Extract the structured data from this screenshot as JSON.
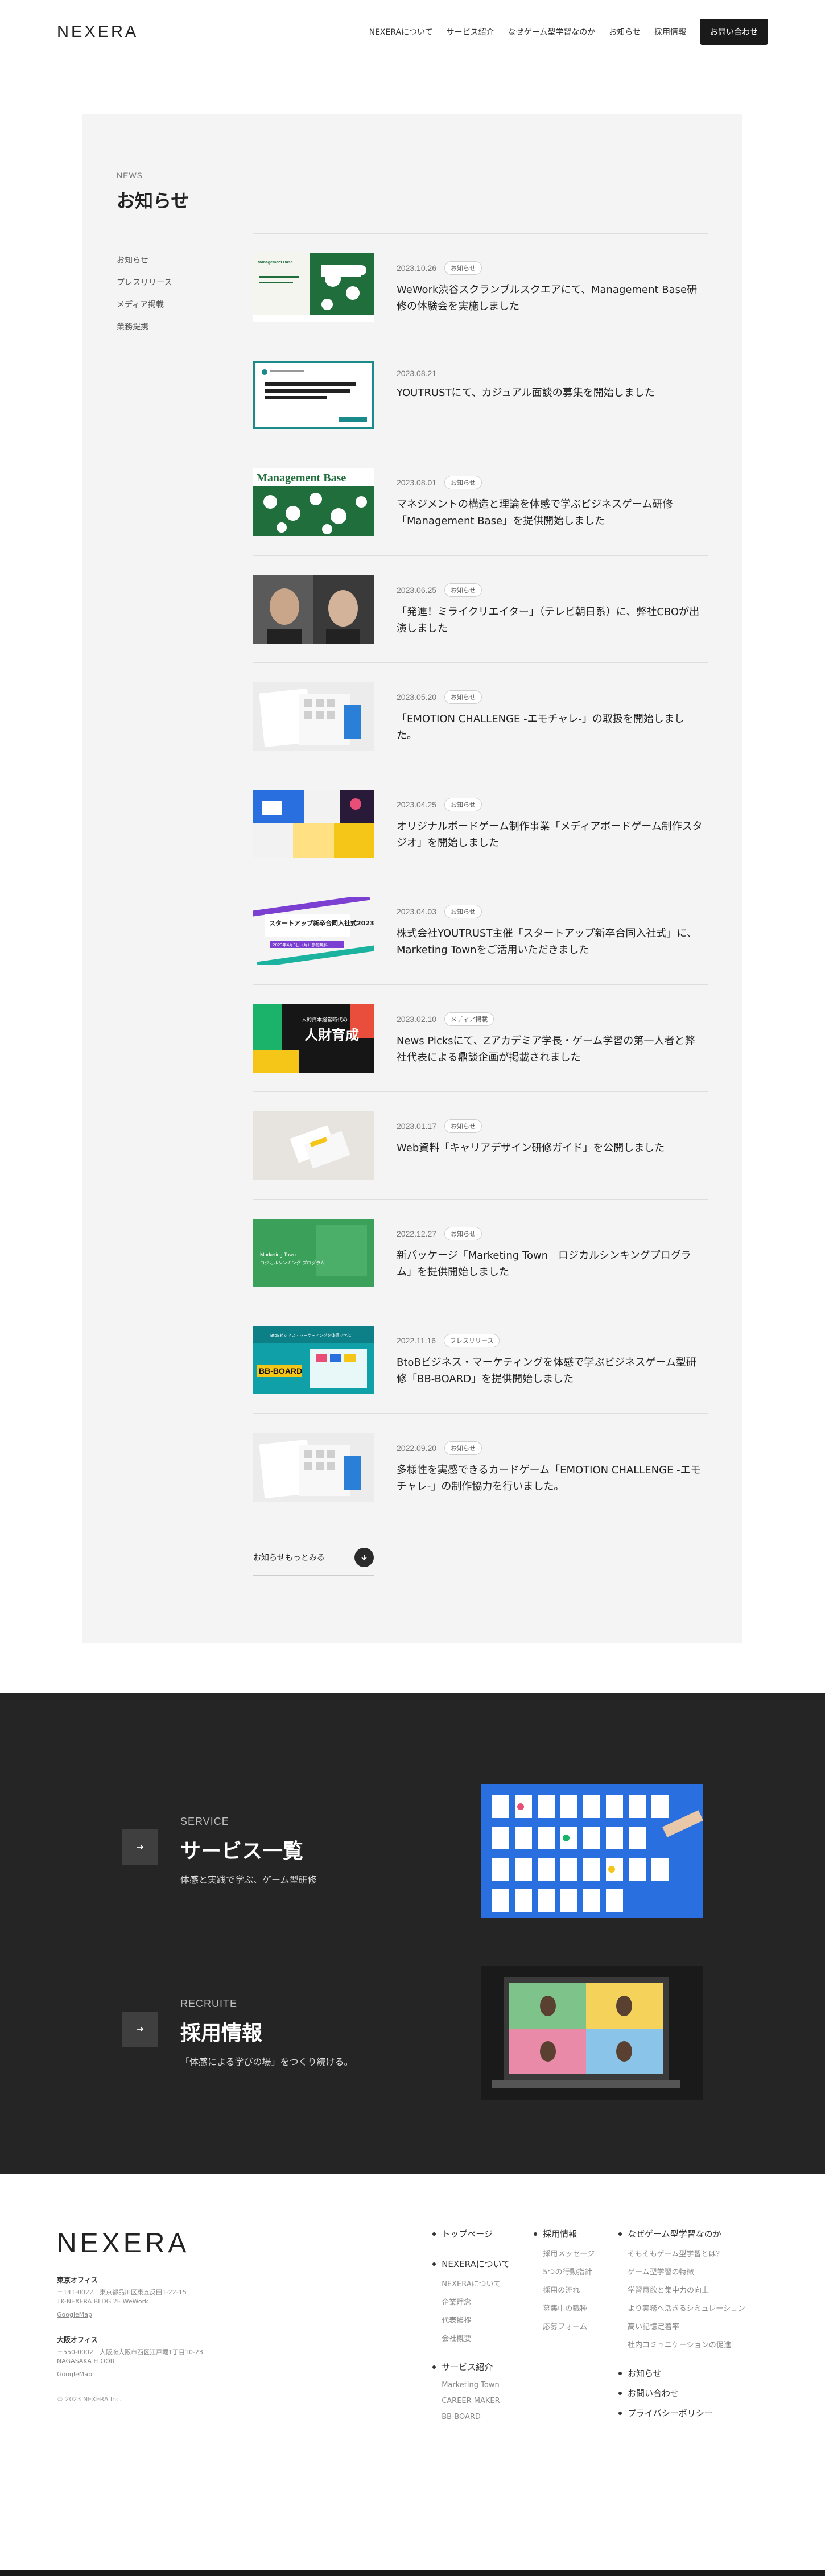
{
  "header": {
    "logo": "NEXERA",
    "nav": [
      {
        "label": "NEXERAについて"
      },
      {
        "label": "サービス紹介"
      },
      {
        "label": "なぜゲーム型学習なのか"
      },
      {
        "label": "お知らせ"
      },
      {
        "label": "採用情報"
      }
    ],
    "cta": "お問い合わせ"
  },
  "news": {
    "eyebrow": "NEWS",
    "title": "お知らせ",
    "categories": [
      "お知らせ",
      "プレスリリース",
      "メディア掲載",
      "業務提携"
    ],
    "items": [
      {
        "date": "2023.10.26",
        "tag": "お知らせ",
        "title": "WeWork渋谷スクランブルスクエアにて、Management Base研修の体験会を実施しました",
        "thumb_text": "Management Base",
        "thumb_sub": "マネジメント・リーダーシップ研修体験会を開催します"
      },
      {
        "date": "2023.08.21",
        "tag": "",
        "title": "YOUTRUSTにて、カジュアル面談の募集を開始しました",
        "thumb_text": "「ゲーム」×「学び」を社会に実装しているベンチャー企業で企画開発を志えませんか？",
        "thumb_sub": "YOUTRUST"
      },
      {
        "date": "2023.08.01",
        "tag": "お知らせ",
        "title": "マネジメントの構造と理論を体感で学ぶビジネスゲーム研修「Management Base」を提供開始しました",
        "thumb_text": "Management Base",
        "thumb_sub": "NEXERA"
      },
      {
        "date": "2023.06.25",
        "tag": "お知らせ",
        "title": "「発進！ミライクリエイター」（テレビ朝日系）に、弊社CBOが出演しました",
        "thumb_text": "",
        "thumb_sub": ""
      },
      {
        "date": "2023.05.20",
        "tag": "お知らせ",
        "title": "「EMOTION CHALLENGE -エモチャレ-」の取扱を開始しました。",
        "thumb_text": "",
        "thumb_sub": ""
      },
      {
        "date": "2023.04.25",
        "tag": "お知らせ",
        "title": "オリジナルボードゲーム制作事業「メディアボードゲーム制作スタジオ」を開始しました",
        "thumb_text": "",
        "thumb_sub": ""
      },
      {
        "date": "2023.04.03",
        "tag": "お知らせ",
        "title": "株式会社YOUTRUST主催「スタートアップ新卒合同入社式」に、Marketing Townをご活用いただきました",
        "thumb_text": "スタートアップ新卒合同入社式2023",
        "thumb_sub": "2023年4月3日（月）参加無料"
      },
      {
        "date": "2023.02.10",
        "tag": "メディア掲載",
        "title": "News Picksにて、Zアカデミア学長・ゲーム学習の第一人者と弊社代表による鼎談企画が掲載されました",
        "thumb_text": "人財育成",
        "thumb_sub": "人的資本経営時代の"
      },
      {
        "date": "2023.01.17",
        "tag": "お知らせ",
        "title": "Web資料「キャリアデザイン研修ガイド」を公開しました",
        "thumb_text": "",
        "thumb_sub": ""
      },
      {
        "date": "2022.12.27",
        "tag": "お知らせ",
        "title": "新パッケージ「Marketing Town　ロジカルシンキングプログラム」を提供開始しました",
        "thumb_text": "Marketing Town",
        "thumb_sub": "ロジカルシンキング プログラム"
      },
      {
        "date": "2022.11.16",
        "tag": "プレスリリース",
        "title": "BtoBビジネス・マーケティングを体感で学ぶビジネスゲーム型研修「BB-BOARD」を提供開始しました",
        "thumb_text": "BB-BOARD",
        "thumb_sub": "BtoBビジネス・マーケティングを体感で学ぶ"
      },
      {
        "date": "2022.09.20",
        "tag": "お知らせ",
        "title": "多様性を実感できるカードゲーム「EMOTION CHALLENGE -エモチャレ-」の制作協力を行いました。",
        "thumb_text": "",
        "thumb_sub": ""
      }
    ],
    "more_label": "お知らせもっとみる"
  },
  "sections": [
    {
      "eyebrow": "SERVICE",
      "title": "サービス一覧",
      "sub": "体感と実践で学ぶ、ゲーム型研修"
    },
    {
      "eyebrow": "RECRUITE",
      "title": "採用情報",
      "sub": "「体感による学びの場」をつくり続ける。"
    }
  ],
  "footer": {
    "logo": "NEXERA",
    "offices": [
      {
        "name": "東京オフィス",
        "addr1": "〒141-0022　東京都品川区東五反田1-22-15",
        "addr2": "TK-NEXERA BLDG 2F WeWork",
        "map": "GoogleMap"
      },
      {
        "name": "大阪オフィス",
        "addr1": "〒550-0002　大阪府大阪市西区江戸堀1丁目10-23",
        "addr2": "NAGASAKA FLOOR",
        "map": "GoogleMap"
      }
    ],
    "copyright": "© 2023 NEXERA Inc.",
    "col1": {
      "groups": [
        {
          "head": "トップページ",
          "subs": []
        },
        {
          "head": "NEXERAについて",
          "subs": [
            "NEXERAについて",
            "企業理念",
            "代表挨拶",
            "会社概要"
          ]
        },
        {
          "head": "サービス紹介",
          "subs": [
            "Marketing Town",
            "CAREER MAKER",
            "BB-BOARD"
          ]
        }
      ]
    },
    "col2": {
      "groups": [
        {
          "head": "採用情報",
          "subs": [
            "採用メッセージ",
            "5つの行動指針",
            "採用の流れ",
            "募集中の職種",
            "応募フォーム"
          ]
        }
      ]
    },
    "col3": {
      "groups": [
        {
          "head": "なぜゲーム型学習なのか",
          "subs": [
            "そもそもゲーム型学習とは？",
            "ゲーム型学習の特徴",
            "学習意欲と集中力の向上",
            "より実務へ活きるシミュレーション",
            "高い記憶定着率",
            "社内コミュニケーションの促進"
          ]
        },
        {
          "head": "お知らせ",
          "subs": []
        },
        {
          "head": "お問い合わせ",
          "subs": []
        },
        {
          "head": "プライバシーポリシー",
          "subs": []
        }
      ]
    }
  },
  "colors": {
    "accent_dark": "#1a1a1a",
    "panel": "#f4f4f4",
    "dark_section": "#252525",
    "green": "#1f6e3c",
    "teal": "#1a8a8a"
  }
}
